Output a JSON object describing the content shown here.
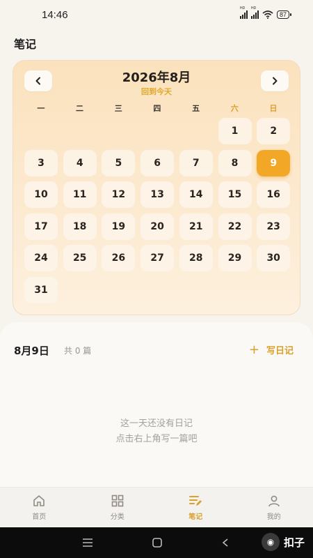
{
  "status_bar": {
    "time": "14:46",
    "battery": "87",
    "signal1_label": "HD",
    "signal2_label": "HD"
  },
  "page": {
    "title": "笔记"
  },
  "calendar": {
    "month_title": "2026年8月",
    "back_to_today": "回到今天",
    "prev_icon": "chevron-left-icon",
    "next_icon": "chevron-right-icon",
    "weekdays": [
      "一",
      "二",
      "三",
      "四",
      "五",
      "六",
      "日"
    ],
    "first_weekday_index": 5,
    "days_in_month": 31,
    "selected_day": 9,
    "colors": {
      "accent": "#f2a826",
      "weekend_header": "#d9a12a"
    }
  },
  "entries": {
    "date_label": "8月9日",
    "count_label": "共 0 篇",
    "write_label": "写日记",
    "write_icon": "plus-icon",
    "empty_line1": "这一天还没有日记",
    "empty_line2": "点击右上角写一篇吧"
  },
  "bottom_nav": {
    "items": [
      {
        "label": "首页",
        "icon": "home-icon",
        "active": false
      },
      {
        "label": "分类",
        "icon": "grid-icon",
        "active": false
      },
      {
        "label": "笔记",
        "icon": "note-edit-icon",
        "active": true
      },
      {
        "label": "我的",
        "icon": "user-icon",
        "active": false
      }
    ],
    "active_color": "#d9a12a"
  },
  "watermark": {
    "text": "扣子",
    "logo": "coze-logo"
  }
}
